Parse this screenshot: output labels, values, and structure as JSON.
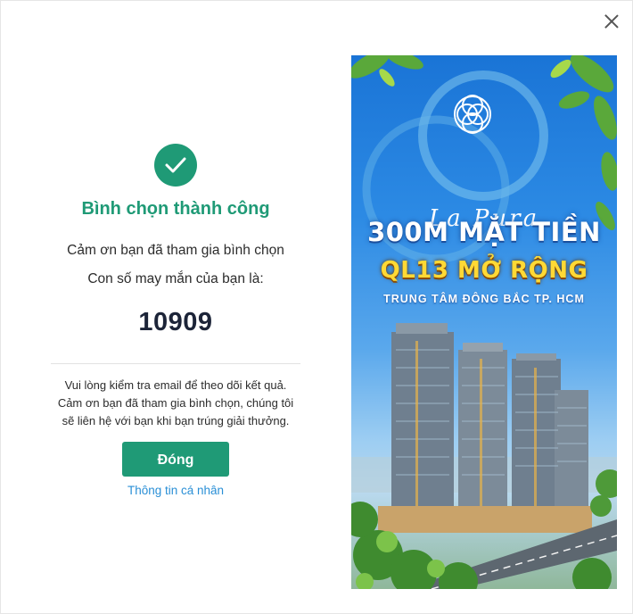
{
  "dialog": {
    "title": "Bình chọn thành công",
    "thanks_line": "Cảm ơn bạn đã tham gia bình chọn",
    "lucky_label": "Con số may mắn của bạn là:",
    "lucky_number": "10909",
    "note_lines": [
      "Vui lòng kiểm tra email để theo dõi kết quả.",
      "Cảm ơn bạn đã tham gia bình chọn, chúng tôi",
      "sẽ liên hệ với bạn khi bạn trúng giải thưởng."
    ],
    "close_button_label": "Đóng",
    "profile_link": "Thông tin cá nhân",
    "accent_color": "#1f9a76",
    "link_color": "#2a8fd6"
  },
  "banner": {
    "logo_text": "La Pura",
    "headline": "300M MẶT TIỀN",
    "subheadline": "QL13 MỞ RỘNG",
    "tagline": "TRUNG TÂM ĐÔNG BẮC TP. HCM"
  },
  "icons": {
    "success": "check-circle-icon",
    "close": "close-icon"
  }
}
